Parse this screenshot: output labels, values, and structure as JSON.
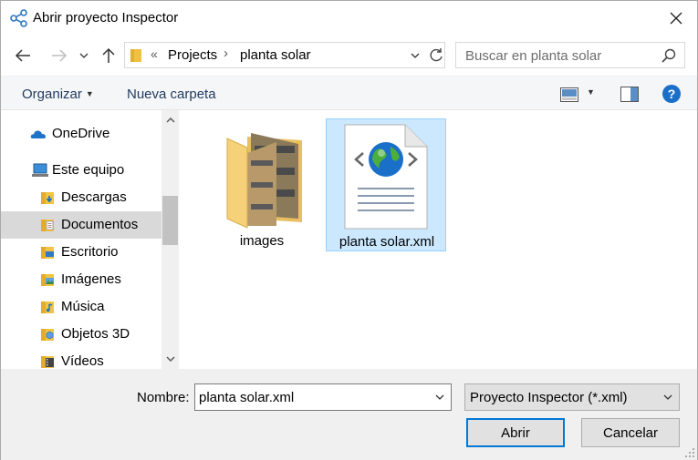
{
  "window": {
    "title": "Abrir proyecto Inspector"
  },
  "address": {
    "overflow": "«",
    "crumbs": [
      "Projects",
      "planta solar"
    ],
    "separator": "›"
  },
  "search": {
    "placeholder": "Buscar en planta solar"
  },
  "toolbar": {
    "organize_label": "Organizar",
    "new_folder_label": "Nueva carpeta"
  },
  "sidebar": {
    "items": [
      {
        "label": "OneDrive",
        "icon": "onedrive-icon"
      },
      {
        "label": "Este equipo",
        "icon": "computer-icon"
      },
      {
        "label": "Descargas",
        "icon": "downloads-folder-icon"
      },
      {
        "label": "Documentos",
        "icon": "documents-folder-icon",
        "selected": true
      },
      {
        "label": "Escritorio",
        "icon": "desktop-folder-icon"
      },
      {
        "label": "Imágenes",
        "icon": "pictures-folder-icon"
      },
      {
        "label": "Música",
        "icon": "music-folder-icon"
      },
      {
        "label": "Objetos 3D",
        "icon": "3d-objects-folder-icon"
      },
      {
        "label": "Vídeos",
        "icon": "videos-folder-icon"
      }
    ]
  },
  "files": [
    {
      "name": "images",
      "type": "folder"
    },
    {
      "name": "planta solar.xml",
      "type": "xml",
      "selected": true
    }
  ],
  "footer": {
    "name_label": "Nombre:",
    "name_value": "planta solar.xml",
    "filter_value": "Proyecto Inspector (*.xml)",
    "open_label": "Abrir",
    "cancel_label": "Cancelar"
  },
  "colors": {
    "accent": "#0078d7",
    "selection": "#cce8ff",
    "selection_border": "#99d1ff"
  }
}
